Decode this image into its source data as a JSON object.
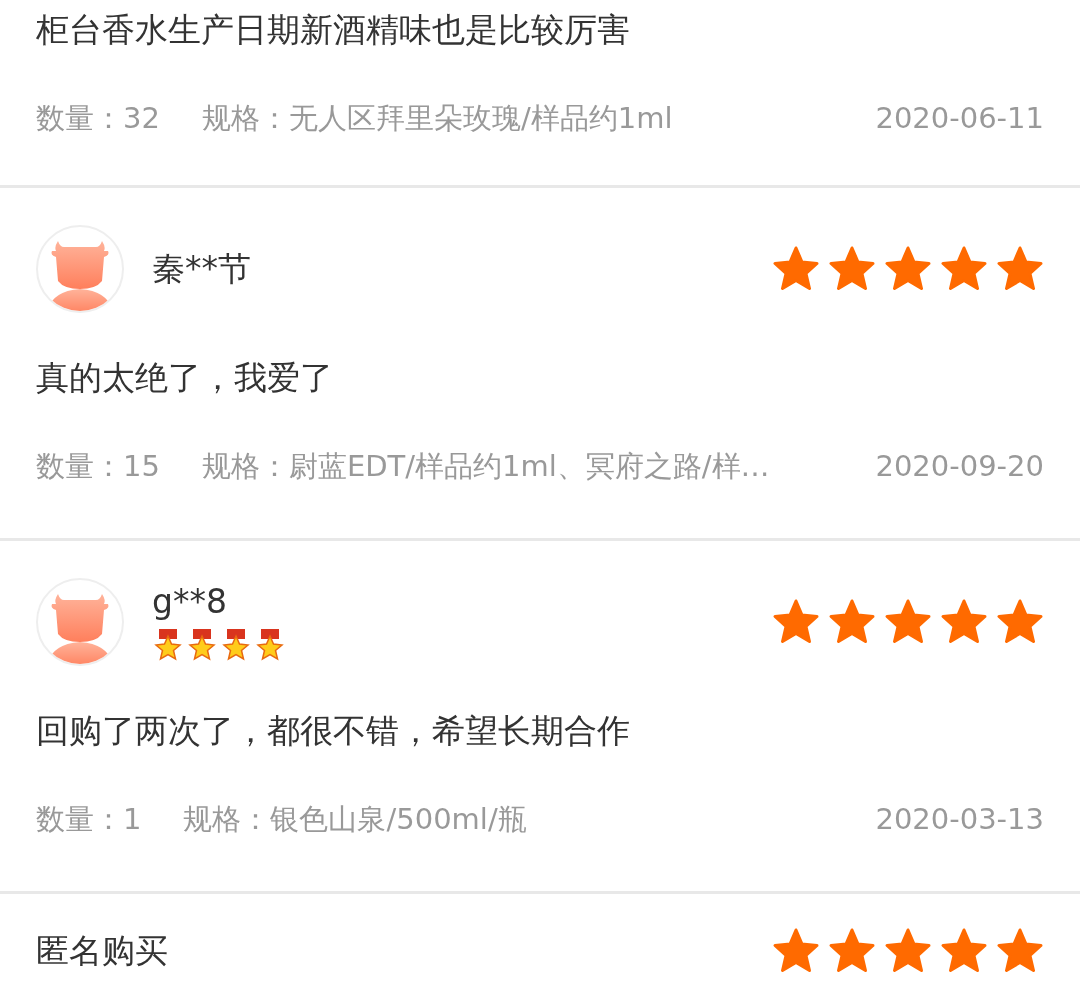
{
  "reviews": [
    {
      "comment": "柜台香水生产日期新酒精味也是比较厉害",
      "quantity": "数量：32",
      "spec": "规格：无人区拜里朵玫瑰/样品约1ml",
      "date": "2020-06-11"
    },
    {
      "user": {
        "name": "秦**节",
        "avatar": true
      },
      "stars": 5,
      "comment": "真的太绝了，我爱了",
      "quantity": "数量：15",
      "spec": "规格：尉蓝EDT/样品约1ml、冥府之路/样…",
      "date": "2020-09-20"
    },
    {
      "user": {
        "name": "g**8",
        "avatar": true
      },
      "badge": {
        "stars": 4
      },
      "stars": 5,
      "comment": "回购了两次了，都很不错，希望长期合作",
      "quantity": "数量：1",
      "spec": "规格：银色山泉/500ml/瓶",
      "date": "2020-03-13"
    },
    {
      "user": {
        "name": "匿名购买",
        "avatar": false
      },
      "stars": 5
    }
  ]
}
